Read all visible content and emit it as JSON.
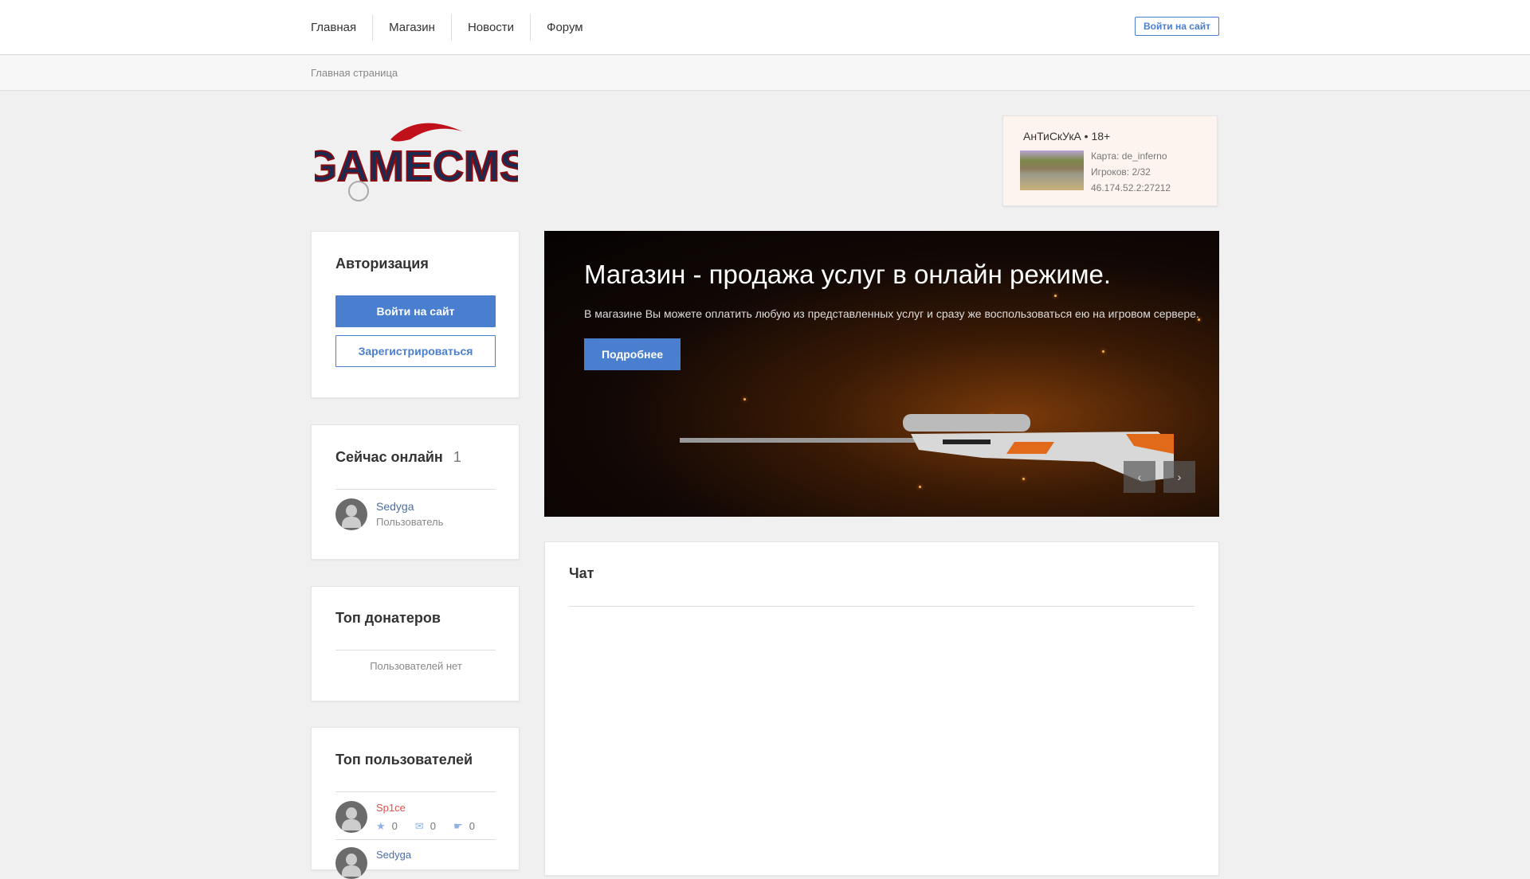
{
  "header": {
    "nav": [
      "Главная",
      "Магазин",
      "Новости",
      "Форум"
    ],
    "login_button": "Войти на сайт"
  },
  "breadcrumb": "Главная страница",
  "logo_text": "GAMECMS",
  "server": {
    "name": "АнТиСкУкА • 18+",
    "map": "Карта: de_inferno",
    "players": "Игроков: 2/32",
    "address": "46.174.52.2:27212"
  },
  "auth": {
    "title": "Авторизация",
    "login": "Войти на сайт",
    "register": "Зарегистрироваться"
  },
  "online": {
    "title": "Сейчас онлайн",
    "count": "1",
    "users": [
      {
        "name": "Sedyga",
        "role": "Пользователь"
      }
    ]
  },
  "donators": {
    "title": "Топ донатеров",
    "empty": "Пользователей нет"
  },
  "top_users": {
    "title": "Топ пользователей",
    "users": [
      {
        "name": "Sp1ce",
        "stars": "0",
        "messages": "0",
        "thanks": "0"
      },
      {
        "name": "Sedyga"
      }
    ]
  },
  "slider": {
    "title": "Магазин - продажа услуг в онлайн режиме.",
    "text": "В магазине Вы можете оплатить любую из представленных услуг и сразу же воспользоваться ею на игровом сервере.",
    "button": "Подробнее",
    "prev": "‹",
    "next": "›"
  },
  "chat": {
    "title": "Чат"
  }
}
